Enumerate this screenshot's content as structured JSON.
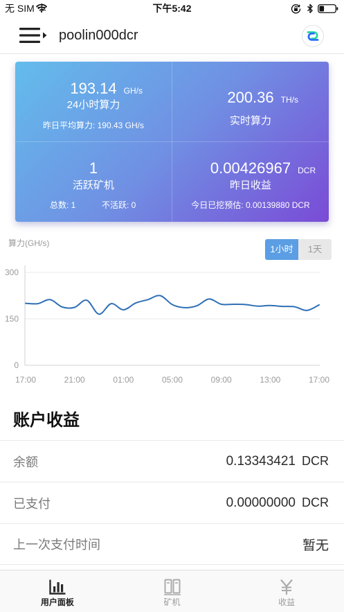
{
  "status_bar": {
    "carrier": "无 SIM 卡",
    "time": "下午5:42",
    "battery_level": 0.3,
    "icons": [
      "wifi-icon",
      "orientation-lock-icon",
      "bluetooth-icon",
      "battery-icon"
    ]
  },
  "header": {
    "title": "poolin000dcr",
    "menu_icon": "menu-expand-icon",
    "logo_icon": "decred-logo-icon"
  },
  "summary_card": {
    "colors": {
      "gradient_start": "#63bcec",
      "gradient_mid": "#7090e3",
      "gradient_end": "#7a4bd6"
    },
    "hashrate_24h": {
      "value": "193.14",
      "unit": "GH/s",
      "label": "24小时算力",
      "detail": "昨日平均算力: 190.43 GH/s"
    },
    "hashrate_realtime": {
      "value": "200.36",
      "unit": "TH/s",
      "label": "实时算力"
    },
    "active_workers": {
      "value": "1",
      "label": "活跃矿机",
      "total": "总数: 1",
      "inactive": "不活跃: 0"
    },
    "yesterday_earnings": {
      "value": "0.00426967",
      "unit": "DCR",
      "label": "昨日收益",
      "detail": "今日已挖预估: 0.00139880 DCR"
    }
  },
  "chart_controls": {
    "active_color": "#5b9ee3",
    "range_tabs": [
      {
        "label": "1小时",
        "active": true
      },
      {
        "label": "1天",
        "active": false
      }
    ]
  },
  "chart_data": {
    "type": "line",
    "title": "",
    "xlabel": "",
    "ylabel": "算力(GH/s)",
    "x": [
      "17:00",
      "18:00",
      "19:00",
      "20:00",
      "21:00",
      "22:00",
      "23:00",
      "00:00",
      "01:00",
      "02:00",
      "03:00",
      "04:00",
      "05:00",
      "06:00",
      "07:00",
      "08:00",
      "09:00",
      "10:00",
      "11:00",
      "12:00",
      "13:00",
      "14:00",
      "15:00",
      "16:00",
      "17:00"
    ],
    "series": [
      {
        "values": [
          200,
          199,
          212,
          188,
          187,
          210,
          165,
          199,
          179,
          201,
          212,
          225,
          196,
          186,
          192,
          214,
          197,
          197,
          196,
          191,
          193,
          190,
          189,
          177,
          195
        ],
        "color": "#2f6fb6"
      }
    ],
    "ylim": [
      0,
      300
    ],
    "yticks": [
      0,
      150,
      300
    ],
    "xticks": [
      "17:00",
      "21:00",
      "01:00",
      "05:00",
      "09:00",
      "13:00",
      "17:00"
    ],
    "grid": true,
    "legend": "none"
  },
  "earnings": {
    "title": "账户收益",
    "rows": [
      {
        "label": "余额",
        "value": "0.13343421",
        "unit": "DCR"
      },
      {
        "label": "已支付",
        "value": "0.00000000",
        "unit": "DCR"
      },
      {
        "label": "上一次支付时间",
        "value": "暂无"
      }
    ]
  },
  "tab_bar": {
    "tabs": [
      {
        "label": "用户面板",
        "icon": "bar-chart-icon",
        "active": true
      },
      {
        "label": "矿机",
        "icon": "miner-icon",
        "active": false
      },
      {
        "label": "收益",
        "icon": "yen-icon",
        "active": false
      }
    ]
  }
}
